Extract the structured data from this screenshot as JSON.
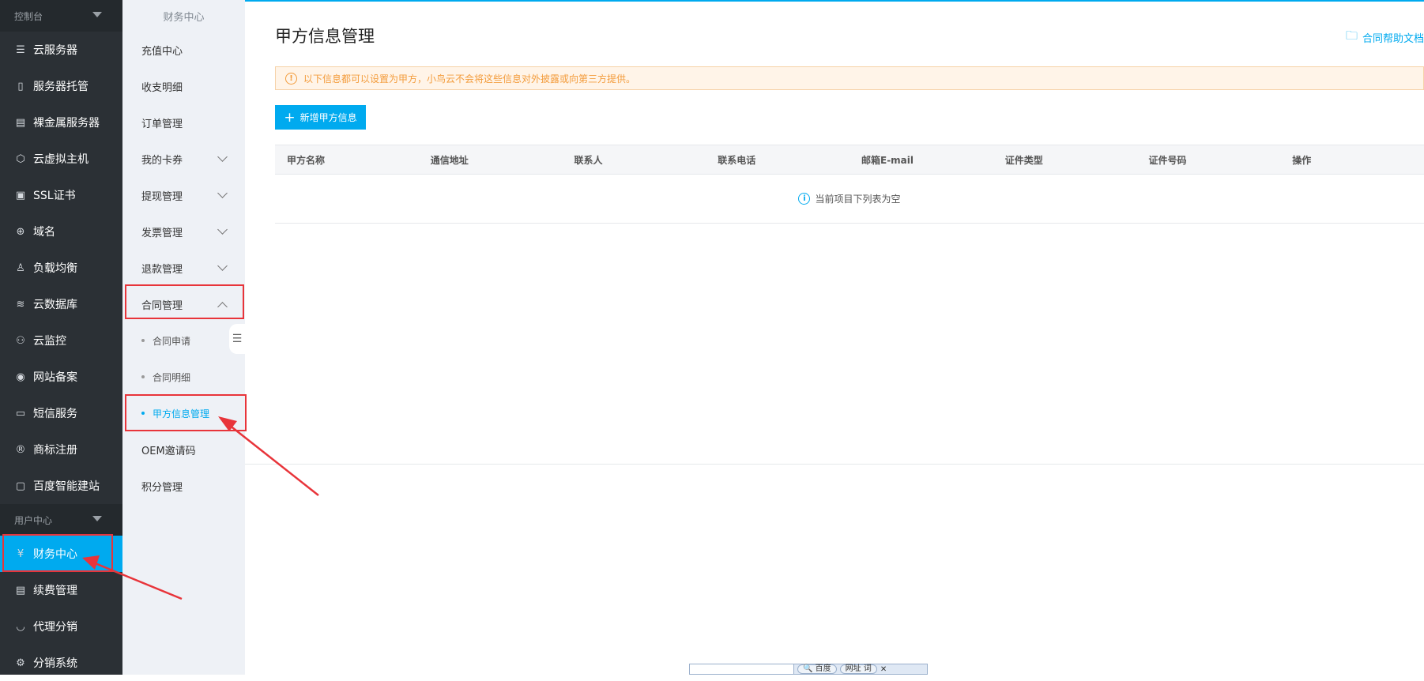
{
  "left_nav": {
    "group1": "控制台",
    "items1": [
      {
        "label": "云服务器",
        "icon": "server-rack-icon",
        "glyph": "☰"
      },
      {
        "label": "服务器托管",
        "icon": "hosting-icon",
        "glyph": "▯"
      },
      {
        "label": "裸金属服务器",
        "icon": "bare-metal-icon",
        "glyph": "▤"
      },
      {
        "label": "云虚拟主机",
        "icon": "cube-icon",
        "glyph": "⬡"
      },
      {
        "label": "SSL证书",
        "icon": "certificate-icon",
        "glyph": "▣"
      },
      {
        "label": "域名",
        "icon": "globe-icon",
        "glyph": "⊕"
      },
      {
        "label": "负载均衡",
        "icon": "load-balancer-icon",
        "glyph": "♙"
      },
      {
        "label": "云数据库",
        "icon": "database-icon",
        "glyph": "≋"
      },
      {
        "label": "云监控",
        "icon": "monitor-icon",
        "glyph": "⚇"
      },
      {
        "label": "网站备案",
        "icon": "record-icon",
        "glyph": "◉"
      },
      {
        "label": "短信服务",
        "icon": "sms-icon",
        "glyph": "▭"
      },
      {
        "label": "商标注册",
        "icon": "trademark-icon",
        "glyph": "®"
      },
      {
        "label": "百度智能建站",
        "icon": "site-builder-icon",
        "glyph": "▢"
      }
    ],
    "group2": "用户中心",
    "items2": [
      {
        "label": "财务中心",
        "icon": "finance-icon",
        "glyph": "¥"
      },
      {
        "label": "续费管理",
        "icon": "renew-icon",
        "glyph": "▤"
      },
      {
        "label": "代理分销",
        "icon": "agent-icon",
        "glyph": "◡"
      },
      {
        "label": "分销系统",
        "icon": "gear-icon",
        "glyph": "⚙"
      }
    ]
  },
  "mid_nav": {
    "title": "财务中心",
    "items": [
      "充值中心",
      "收支明细",
      "订单管理",
      "我的卡券",
      "提现管理",
      "发票管理",
      "退款管理",
      "合同管理"
    ],
    "subs": [
      "合同申请",
      "合同明细",
      "甲方信息管理"
    ],
    "items_after": [
      "OEM邀请码",
      "积分管理"
    ]
  },
  "main": {
    "title": "甲方信息管理",
    "help_label": "合同帮助文档",
    "notice": "以下信息都可以设置为甲方，小鸟云不会将这些信息对外披露或向第三方提供。",
    "add_button": "新增甲方信息",
    "columns": [
      "甲方名称",
      "通信地址",
      "联系人",
      "联系电话",
      "邮箱E-mail",
      "证件类型",
      "证件号码",
      "操作"
    ],
    "empty_text": "当前项目下列表为空"
  },
  "ime_bar": {
    "baidu": "百度",
    "url": "网址",
    "word": "词"
  },
  "colors": {
    "accent": "#00aaef",
    "sidebar": "#2b3035",
    "highlight": "#e8343a",
    "warning": "#f39c3c"
  }
}
